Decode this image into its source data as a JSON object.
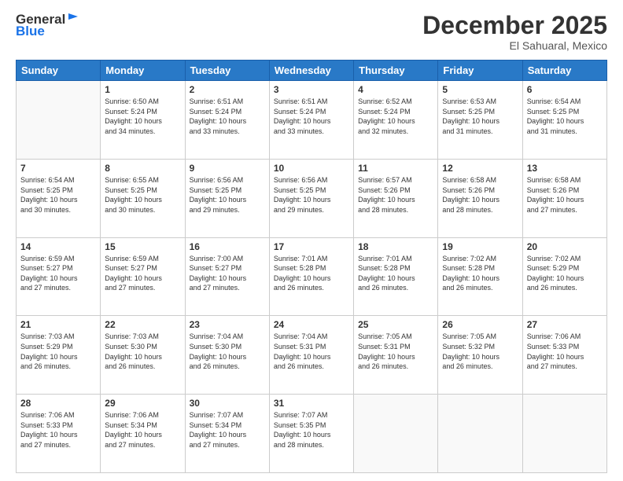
{
  "logo": {
    "line1": "General",
    "line2": "Blue"
  },
  "header": {
    "month": "December 2025",
    "location": "El Sahuaral, Mexico"
  },
  "days_of_week": [
    "Sunday",
    "Monday",
    "Tuesday",
    "Wednesday",
    "Thursday",
    "Friday",
    "Saturday"
  ],
  "weeks": [
    [
      {
        "day": "",
        "info": ""
      },
      {
        "day": "1",
        "info": "Sunrise: 6:50 AM\nSunset: 5:24 PM\nDaylight: 10 hours\nand 34 minutes."
      },
      {
        "day": "2",
        "info": "Sunrise: 6:51 AM\nSunset: 5:24 PM\nDaylight: 10 hours\nand 33 minutes."
      },
      {
        "day": "3",
        "info": "Sunrise: 6:51 AM\nSunset: 5:24 PM\nDaylight: 10 hours\nand 33 minutes."
      },
      {
        "day": "4",
        "info": "Sunrise: 6:52 AM\nSunset: 5:24 PM\nDaylight: 10 hours\nand 32 minutes."
      },
      {
        "day": "5",
        "info": "Sunrise: 6:53 AM\nSunset: 5:25 PM\nDaylight: 10 hours\nand 31 minutes."
      },
      {
        "day": "6",
        "info": "Sunrise: 6:54 AM\nSunset: 5:25 PM\nDaylight: 10 hours\nand 31 minutes."
      }
    ],
    [
      {
        "day": "7",
        "info": "Sunrise: 6:54 AM\nSunset: 5:25 PM\nDaylight: 10 hours\nand 30 minutes."
      },
      {
        "day": "8",
        "info": "Sunrise: 6:55 AM\nSunset: 5:25 PM\nDaylight: 10 hours\nand 30 minutes."
      },
      {
        "day": "9",
        "info": "Sunrise: 6:56 AM\nSunset: 5:25 PM\nDaylight: 10 hours\nand 29 minutes."
      },
      {
        "day": "10",
        "info": "Sunrise: 6:56 AM\nSunset: 5:25 PM\nDaylight: 10 hours\nand 29 minutes."
      },
      {
        "day": "11",
        "info": "Sunrise: 6:57 AM\nSunset: 5:26 PM\nDaylight: 10 hours\nand 28 minutes."
      },
      {
        "day": "12",
        "info": "Sunrise: 6:58 AM\nSunset: 5:26 PM\nDaylight: 10 hours\nand 28 minutes."
      },
      {
        "day": "13",
        "info": "Sunrise: 6:58 AM\nSunset: 5:26 PM\nDaylight: 10 hours\nand 27 minutes."
      }
    ],
    [
      {
        "day": "14",
        "info": "Sunrise: 6:59 AM\nSunset: 5:27 PM\nDaylight: 10 hours\nand 27 minutes."
      },
      {
        "day": "15",
        "info": "Sunrise: 6:59 AM\nSunset: 5:27 PM\nDaylight: 10 hours\nand 27 minutes."
      },
      {
        "day": "16",
        "info": "Sunrise: 7:00 AM\nSunset: 5:27 PM\nDaylight: 10 hours\nand 27 minutes."
      },
      {
        "day": "17",
        "info": "Sunrise: 7:01 AM\nSunset: 5:28 PM\nDaylight: 10 hours\nand 26 minutes."
      },
      {
        "day": "18",
        "info": "Sunrise: 7:01 AM\nSunset: 5:28 PM\nDaylight: 10 hours\nand 26 minutes."
      },
      {
        "day": "19",
        "info": "Sunrise: 7:02 AM\nSunset: 5:28 PM\nDaylight: 10 hours\nand 26 minutes."
      },
      {
        "day": "20",
        "info": "Sunrise: 7:02 AM\nSunset: 5:29 PM\nDaylight: 10 hours\nand 26 minutes."
      }
    ],
    [
      {
        "day": "21",
        "info": "Sunrise: 7:03 AM\nSunset: 5:29 PM\nDaylight: 10 hours\nand 26 minutes."
      },
      {
        "day": "22",
        "info": "Sunrise: 7:03 AM\nSunset: 5:30 PM\nDaylight: 10 hours\nand 26 minutes."
      },
      {
        "day": "23",
        "info": "Sunrise: 7:04 AM\nSunset: 5:30 PM\nDaylight: 10 hours\nand 26 minutes."
      },
      {
        "day": "24",
        "info": "Sunrise: 7:04 AM\nSunset: 5:31 PM\nDaylight: 10 hours\nand 26 minutes."
      },
      {
        "day": "25",
        "info": "Sunrise: 7:05 AM\nSunset: 5:31 PM\nDaylight: 10 hours\nand 26 minutes."
      },
      {
        "day": "26",
        "info": "Sunrise: 7:05 AM\nSunset: 5:32 PM\nDaylight: 10 hours\nand 26 minutes."
      },
      {
        "day": "27",
        "info": "Sunrise: 7:06 AM\nSunset: 5:33 PM\nDaylight: 10 hours\nand 27 minutes."
      }
    ],
    [
      {
        "day": "28",
        "info": "Sunrise: 7:06 AM\nSunset: 5:33 PM\nDaylight: 10 hours\nand 27 minutes."
      },
      {
        "day": "29",
        "info": "Sunrise: 7:06 AM\nSunset: 5:34 PM\nDaylight: 10 hours\nand 27 minutes."
      },
      {
        "day": "30",
        "info": "Sunrise: 7:07 AM\nSunset: 5:34 PM\nDaylight: 10 hours\nand 27 minutes."
      },
      {
        "day": "31",
        "info": "Sunrise: 7:07 AM\nSunset: 5:35 PM\nDaylight: 10 hours\nand 28 minutes."
      },
      {
        "day": "",
        "info": ""
      },
      {
        "day": "",
        "info": ""
      },
      {
        "day": "",
        "info": ""
      }
    ]
  ]
}
